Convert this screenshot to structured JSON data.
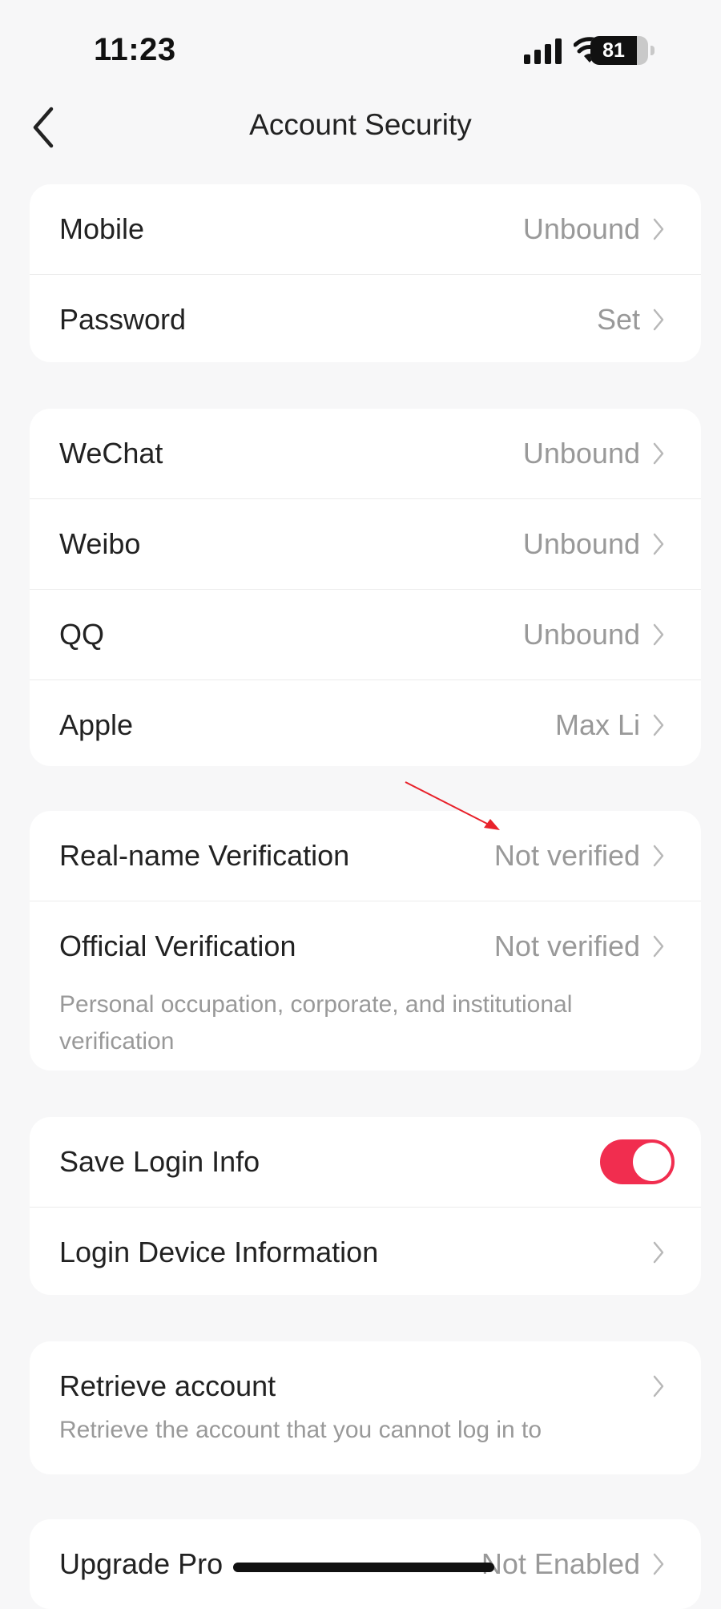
{
  "status_bar": {
    "time": "11:23",
    "battery": "81",
    "battery_level": 0.81
  },
  "nav": {
    "title": "Account Security",
    "back_icon": "chevron-left-icon"
  },
  "groups": [
    {
      "rows": [
        {
          "label": "Mobile",
          "value": "Unbound"
        },
        {
          "label": "Password",
          "value": "Set"
        }
      ]
    },
    {
      "rows": [
        {
          "label": "WeChat",
          "value": "Unbound"
        },
        {
          "label": "Weibo",
          "value": "Unbound"
        },
        {
          "label": "QQ",
          "value": "Unbound"
        },
        {
          "label": "Apple",
          "value": "Max Li"
        }
      ]
    },
    {
      "rows": [
        {
          "label": "Real-name Verification",
          "value": "Not verified"
        },
        {
          "label": "Official Verification",
          "value": "Not verified",
          "description": "Personal occupation, corporate, and institutional verification"
        }
      ]
    },
    {
      "rows": [
        {
          "label": "Save Login Info",
          "toggle_on": true
        },
        {
          "label": "Login Device Information",
          "value": ""
        }
      ]
    },
    {
      "rows": [
        {
          "label": "Retrieve account",
          "value": "",
          "description": "Retrieve the account that you cannot log in to"
        }
      ]
    },
    {
      "rows": [
        {
          "label": "Upgrade Pro",
          "value": "Not Enabled"
        }
      ]
    }
  ],
  "colors": {
    "accent": "#f12d4f",
    "background": "#f7f7f8",
    "card": "#ffffff",
    "secondary_text": "#999999",
    "annotation": "#e8222b"
  }
}
